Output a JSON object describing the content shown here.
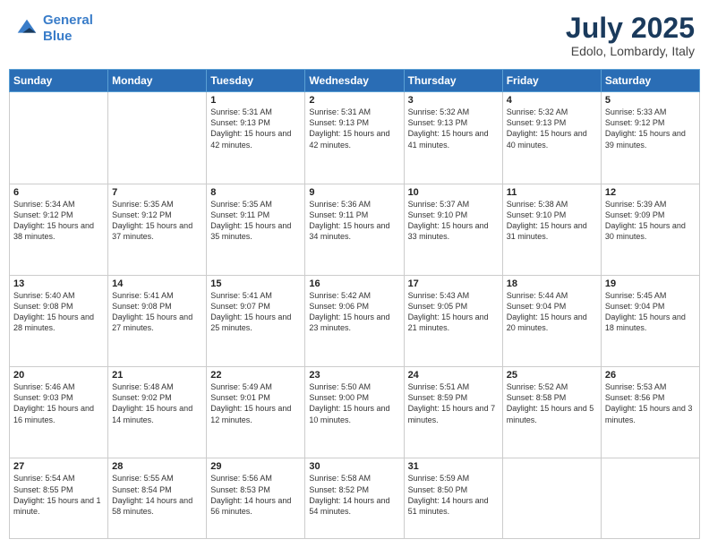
{
  "header": {
    "logo_line1": "General",
    "logo_line2": "Blue",
    "month": "July 2025",
    "location": "Edolo, Lombardy, Italy"
  },
  "weekdays": [
    "Sunday",
    "Monday",
    "Tuesday",
    "Wednesday",
    "Thursday",
    "Friday",
    "Saturday"
  ],
  "weeks": [
    [
      {
        "day": "",
        "info": ""
      },
      {
        "day": "",
        "info": ""
      },
      {
        "day": "1",
        "info": "Sunrise: 5:31 AM\nSunset: 9:13 PM\nDaylight: 15 hours\nand 42 minutes."
      },
      {
        "day": "2",
        "info": "Sunrise: 5:31 AM\nSunset: 9:13 PM\nDaylight: 15 hours\nand 42 minutes."
      },
      {
        "day": "3",
        "info": "Sunrise: 5:32 AM\nSunset: 9:13 PM\nDaylight: 15 hours\nand 41 minutes."
      },
      {
        "day": "4",
        "info": "Sunrise: 5:32 AM\nSunset: 9:13 PM\nDaylight: 15 hours\nand 40 minutes."
      },
      {
        "day": "5",
        "info": "Sunrise: 5:33 AM\nSunset: 9:12 PM\nDaylight: 15 hours\nand 39 minutes."
      }
    ],
    [
      {
        "day": "6",
        "info": "Sunrise: 5:34 AM\nSunset: 9:12 PM\nDaylight: 15 hours\nand 38 minutes."
      },
      {
        "day": "7",
        "info": "Sunrise: 5:35 AM\nSunset: 9:12 PM\nDaylight: 15 hours\nand 37 minutes."
      },
      {
        "day": "8",
        "info": "Sunrise: 5:35 AM\nSunset: 9:11 PM\nDaylight: 15 hours\nand 35 minutes."
      },
      {
        "day": "9",
        "info": "Sunrise: 5:36 AM\nSunset: 9:11 PM\nDaylight: 15 hours\nand 34 minutes."
      },
      {
        "day": "10",
        "info": "Sunrise: 5:37 AM\nSunset: 9:10 PM\nDaylight: 15 hours\nand 33 minutes."
      },
      {
        "day": "11",
        "info": "Sunrise: 5:38 AM\nSunset: 9:10 PM\nDaylight: 15 hours\nand 31 minutes."
      },
      {
        "day": "12",
        "info": "Sunrise: 5:39 AM\nSunset: 9:09 PM\nDaylight: 15 hours\nand 30 minutes."
      }
    ],
    [
      {
        "day": "13",
        "info": "Sunrise: 5:40 AM\nSunset: 9:08 PM\nDaylight: 15 hours\nand 28 minutes."
      },
      {
        "day": "14",
        "info": "Sunrise: 5:41 AM\nSunset: 9:08 PM\nDaylight: 15 hours\nand 27 minutes."
      },
      {
        "day": "15",
        "info": "Sunrise: 5:41 AM\nSunset: 9:07 PM\nDaylight: 15 hours\nand 25 minutes."
      },
      {
        "day": "16",
        "info": "Sunrise: 5:42 AM\nSunset: 9:06 PM\nDaylight: 15 hours\nand 23 minutes."
      },
      {
        "day": "17",
        "info": "Sunrise: 5:43 AM\nSunset: 9:05 PM\nDaylight: 15 hours\nand 21 minutes."
      },
      {
        "day": "18",
        "info": "Sunrise: 5:44 AM\nSunset: 9:04 PM\nDaylight: 15 hours\nand 20 minutes."
      },
      {
        "day": "19",
        "info": "Sunrise: 5:45 AM\nSunset: 9:04 PM\nDaylight: 15 hours\nand 18 minutes."
      }
    ],
    [
      {
        "day": "20",
        "info": "Sunrise: 5:46 AM\nSunset: 9:03 PM\nDaylight: 15 hours\nand 16 minutes."
      },
      {
        "day": "21",
        "info": "Sunrise: 5:48 AM\nSunset: 9:02 PM\nDaylight: 15 hours\nand 14 minutes."
      },
      {
        "day": "22",
        "info": "Sunrise: 5:49 AM\nSunset: 9:01 PM\nDaylight: 15 hours\nand 12 minutes."
      },
      {
        "day": "23",
        "info": "Sunrise: 5:50 AM\nSunset: 9:00 PM\nDaylight: 15 hours\nand 10 minutes."
      },
      {
        "day": "24",
        "info": "Sunrise: 5:51 AM\nSunset: 8:59 PM\nDaylight: 15 hours\nand 7 minutes."
      },
      {
        "day": "25",
        "info": "Sunrise: 5:52 AM\nSunset: 8:58 PM\nDaylight: 15 hours\nand 5 minutes."
      },
      {
        "day": "26",
        "info": "Sunrise: 5:53 AM\nSunset: 8:56 PM\nDaylight: 15 hours\nand 3 minutes."
      }
    ],
    [
      {
        "day": "27",
        "info": "Sunrise: 5:54 AM\nSunset: 8:55 PM\nDaylight: 15 hours\nand 1 minute."
      },
      {
        "day": "28",
        "info": "Sunrise: 5:55 AM\nSunset: 8:54 PM\nDaylight: 14 hours\nand 58 minutes."
      },
      {
        "day": "29",
        "info": "Sunrise: 5:56 AM\nSunset: 8:53 PM\nDaylight: 14 hours\nand 56 minutes."
      },
      {
        "day": "30",
        "info": "Sunrise: 5:58 AM\nSunset: 8:52 PM\nDaylight: 14 hours\nand 54 minutes."
      },
      {
        "day": "31",
        "info": "Sunrise: 5:59 AM\nSunset: 8:50 PM\nDaylight: 14 hours\nand 51 minutes."
      },
      {
        "day": "",
        "info": ""
      },
      {
        "day": "",
        "info": ""
      }
    ]
  ]
}
